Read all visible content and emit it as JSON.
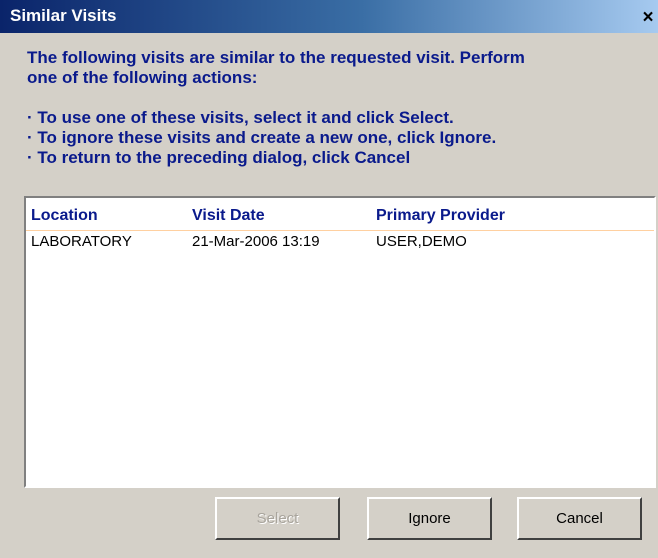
{
  "window": {
    "title": "Similar Visits",
    "close_glyph": "×"
  },
  "instructions": {
    "intro": "The following visits are similar to the requested visit.  Perform\none of the following actions:",
    "options": [
      "· To use one of these visits, select it and click Select.",
      "· To ignore these visits and create a new one, click Ignore.",
      "· To return to the preceding dialog, click Cancel"
    ]
  },
  "visits": {
    "columns": [
      "Location",
      "Visit Date",
      "Primary Provider"
    ],
    "rows": [
      {
        "location": "LABORATORY",
        "visit_date": "21-Mar-2006 13:19",
        "provider": "USER,DEMO"
      }
    ]
  },
  "buttons": {
    "select": {
      "label": "Select",
      "enabled": false
    },
    "ignore": {
      "label": "Ignore",
      "enabled": true
    },
    "cancel": {
      "label": "Cancel",
      "enabled": true
    }
  },
  "colors": {
    "titlebar_start": "#0a246a",
    "titlebar_end": "#a6caf0",
    "dialog_background": "#d4d0c8",
    "instruction_text": "#0a1a8c"
  },
  "icons": {
    "close": "close-icon"
  }
}
